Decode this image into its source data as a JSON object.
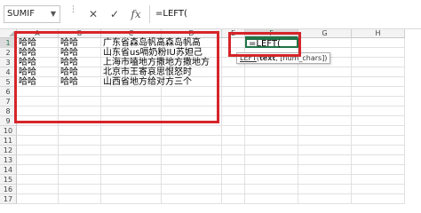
{
  "formula_bar": {
    "name_box": "SUMIF",
    "cancel_icon": "✕",
    "enter_icon": "✓",
    "function_icon": "fx",
    "formula": "=LEFT("
  },
  "columns": [
    "A",
    "B",
    "C",
    "D",
    "E",
    "F",
    "G",
    "H"
  ],
  "active_column": "F",
  "rows": [
    "1",
    "2",
    "3",
    "4",
    "5",
    "6",
    "7",
    "8",
    "9",
    "10",
    "11",
    "12",
    "13",
    "14",
    "15",
    "16",
    "17"
  ],
  "active_row": "1",
  "data": [
    [
      "哈哈",
      "哈哈",
      "广东省森岛帆高森岛帆高"
    ],
    [
      "哈哈",
      "哈哈",
      "山东省us嗝奶粉IU苏妲己"
    ],
    [
      "哈哈",
      "哈哈",
      "上海市嗑地方撒地方撒地方"
    ],
    [
      "哈哈",
      "哈哈",
      "北京市王寄哀思恨怒时"
    ],
    [
      "哈哈",
      "哈哈",
      "山西省地方给对方三个"
    ]
  ],
  "active_cell": {
    "ref": "F1",
    "content": "=LEFT("
  },
  "tooltip": {
    "function_name": "LEFT",
    "open_paren": "(",
    "arg_text": "text",
    "rest": ", [num_chars])"
  },
  "colors": {
    "annotation_red": "#d6252a",
    "excel_green": "#217346"
  }
}
